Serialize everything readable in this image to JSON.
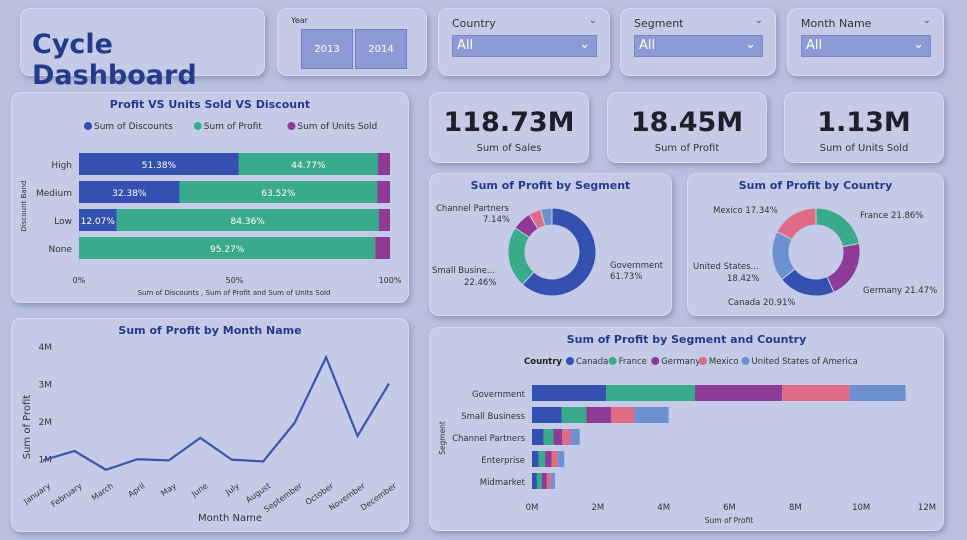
{
  "dashboard": {
    "title": "Cycle Dashboard"
  },
  "year_slicer": {
    "label": "Year",
    "options": [
      "2013",
      "2014"
    ]
  },
  "filters": [
    {
      "label": "Country",
      "value": "All"
    },
    {
      "label": "Segment",
      "value": "All"
    },
    {
      "label": "Month Name",
      "value": "All"
    }
  ],
  "kpis": [
    {
      "value": "118.73M",
      "label": "Sum of  Sales"
    },
    {
      "value": "18.45M",
      "label": "Sum of  Profit"
    },
    {
      "value": "1.13M",
      "label": "Sum of  Units Sold"
    }
  ],
  "colors": {
    "blue": "#3451b2",
    "teal": "#3aaa8c",
    "purple": "#8e3a97",
    "pink": "#e06b86",
    "lightblue": "#6c90d0",
    "line": "#3b55b0"
  },
  "chart_data": [
    {
      "id": "discount",
      "type": "bar",
      "title": "Profit VS Units Sold VS Discount",
      "orientation": "horizontal-stacked-100",
      "ylabel": "Discount Band",
      "xlabel": "Sum of Discounts , Sum of Profit and Sum of Units Sold",
      "categories": [
        "High",
        "Medium",
        "Low",
        "None"
      ],
      "x_ticks": [
        "0%",
        "50%",
        "100%"
      ],
      "series": [
        {
          "name": "Sum of  Discounts",
          "values": [
            51.38,
            32.38,
            12.07,
            0
          ],
          "labels": [
            "51.38%",
            "32.38%",
            "12.07%",
            ""
          ]
        },
        {
          "name": "Sum of  Profit",
          "values": [
            44.77,
            63.52,
            84.36,
            95.27
          ],
          "labels": [
            "44.77%",
            "63.52%",
            "84.36%",
            "95.27%"
          ]
        },
        {
          "name": "Sum of  Units Sold",
          "values": [
            3.85,
            4.1,
            3.57,
            4.73
          ],
          "labels": [
            "",
            "",
            "",
            ""
          ]
        }
      ],
      "legend": "top"
    },
    {
      "id": "month",
      "type": "line",
      "title": "Sum of Profit by Month Name",
      "xlabel": "Month Name",
      "ylabel": "Sum of Profit",
      "categories": [
        "January",
        "February",
        "March",
        "April",
        "May",
        "June",
        "July",
        "August",
        "September",
        "October",
        "November",
        "December"
      ],
      "values": [
        0.95,
        1.2,
        0.7,
        0.98,
        0.95,
        1.55,
        0.97,
        0.92,
        1.95,
        3.7,
        1.6,
        3.0
      ],
      "y_ticks": [
        "1M",
        "2M",
        "3M",
        "4M"
      ],
      "ylim": [
        0,
        4
      ]
    },
    {
      "id": "segment",
      "type": "pie",
      "title": "Sum of Profit by Segment",
      "donut": true,
      "slices": [
        {
          "name": "Government",
          "value": 61.73,
          "label": "61.73%"
        },
        {
          "name": "Small Busine...",
          "value": 22.46,
          "label": "22.46%"
        },
        {
          "name": "Channel Partners",
          "value": 7.14,
          "label": "7.14%"
        },
        {
          "name": "Enterprise",
          "value": 4.5,
          "label": ""
        },
        {
          "name": "Midmarket",
          "value": 4.17,
          "label": ""
        }
      ]
    },
    {
      "id": "country",
      "type": "pie",
      "title": "Sum of Profit by Country",
      "donut": true,
      "slices": [
        {
          "name": "France",
          "value": 21.86,
          "label": "21.86%"
        },
        {
          "name": "Germany",
          "value": 21.47,
          "label": "21.47%"
        },
        {
          "name": "Canada",
          "value": 20.91,
          "label": "20.91%"
        },
        {
          "name": "United States...",
          "value": 18.42,
          "label": "18.42%"
        },
        {
          "name": "Mexico",
          "value": 17.34,
          "label": "17.34%"
        }
      ]
    },
    {
      "id": "segcountry",
      "type": "bar",
      "title": "Sum of Profit by Segment and Country",
      "orientation": "horizontal-stacked",
      "legend_title": "Country",
      "xlabel": "Sum of Profit",
      "ylabel": "Segment",
      "categories": [
        "Government",
        "Small Business",
        "Channel Partners",
        "Enterprise",
        "Midmarket"
      ],
      "x_ticks": [
        "0M",
        "2M",
        "4M",
        "6M",
        "8M",
        "10M",
        "12M"
      ],
      "xlim": [
        0,
        12
      ],
      "series": [
        {
          "name": "Canada",
          "values": [
            2.25,
            0.9,
            0.35,
            0.2,
            0.15
          ]
        },
        {
          "name": "France",
          "values": [
            2.7,
            0.75,
            0.3,
            0.2,
            0.15
          ]
        },
        {
          "name": "Germany",
          "values": [
            2.65,
            0.75,
            0.27,
            0.2,
            0.15
          ]
        },
        {
          "name": "Mexico",
          "values": [
            2.05,
            0.7,
            0.25,
            0.18,
            0.12
          ]
        },
        {
          "name": "United States of America",
          "values": [
            1.7,
            1.05,
            0.28,
            0.2,
            0.13
          ]
        }
      ]
    }
  ]
}
